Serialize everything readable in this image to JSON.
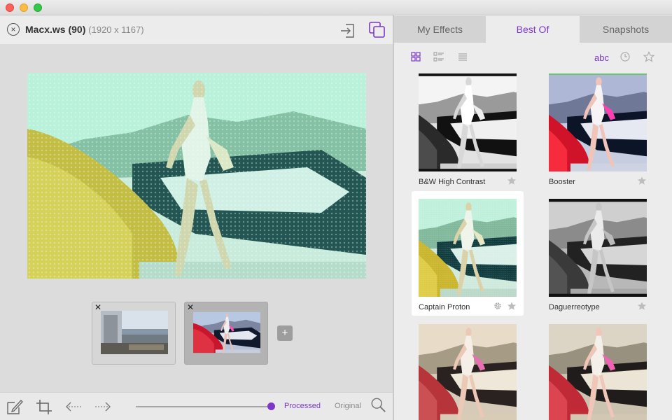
{
  "window": {
    "title": "Macx.ws",
    "count": "(90)",
    "dimensions": "(1920 x 1167)"
  },
  "tabs": [
    {
      "label": "My Effects",
      "active": false
    },
    {
      "label": "Best Of",
      "active": true
    },
    {
      "label": "Snapshots",
      "active": false
    }
  ],
  "view": {
    "sort_label": "abc"
  },
  "snapshots": {
    "add_label": "+"
  },
  "toolbar": {
    "processed_label": "Processed",
    "original_label": "Original",
    "blend": 1.0
  },
  "effects": [
    {
      "name": "B&W High Contrast",
      "style": "bw-high"
    },
    {
      "name": "Booster",
      "style": "booster"
    },
    {
      "name": "Captain Proton",
      "style": "proton",
      "selected": true
    },
    {
      "name": "Daguerreotype",
      "style": "dag"
    },
    {
      "name": "",
      "style": "warm"
    },
    {
      "name": "",
      "style": "warm2"
    }
  ],
  "colors": {
    "accent": "#7d37c9",
    "tab_inactive": "#d3d3d3",
    "panel": "#ececec"
  }
}
